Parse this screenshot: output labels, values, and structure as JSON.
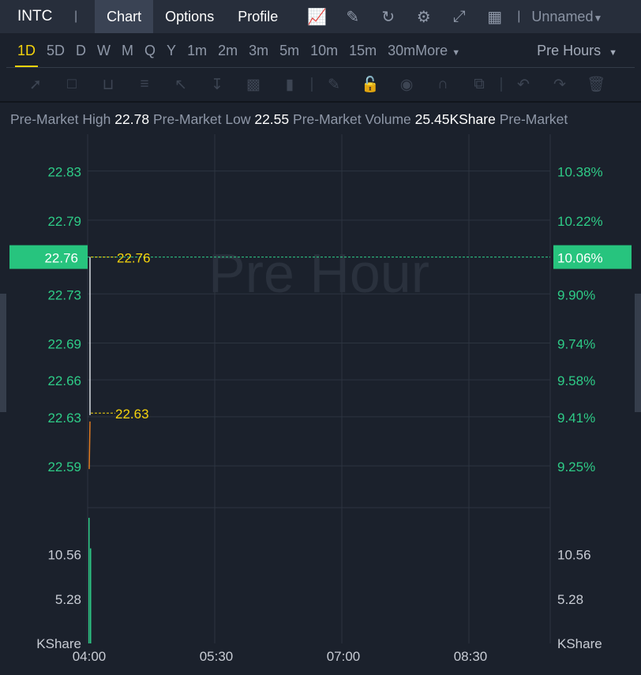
{
  "header": {
    "symbol": "INTC",
    "tabs": [
      "Chart",
      "Options",
      "Profile"
    ],
    "active_tab": "Chart",
    "layout_name": "Unnamed"
  },
  "timeframes": {
    "items": [
      "1D",
      "5D",
      "D",
      "W",
      "M",
      "Q",
      "Y",
      "1m",
      "2m",
      "3m",
      "5m",
      "10m",
      "15m",
      "30m",
      "More"
    ],
    "active": "1D",
    "session": "Pre Hours"
  },
  "info": {
    "high_label": "Pre-Market High",
    "high": "22.78",
    "low_label": "Pre-Market Low",
    "low": "22.55",
    "vol_label": "Pre-Market Volume",
    "vol": "25.45KShare",
    "trail": "Pre-Market"
  },
  "colors": {
    "up": "#2ecc87",
    "accent": "#f5d30c",
    "current": "#27c47e"
  },
  "chart_data": {
    "type": "line",
    "watermark": "Pre Hour",
    "price_ticks": [
      "22.83",
      "22.79",
      "22.73",
      "22.69",
      "22.66",
      "22.63",
      "22.59"
    ],
    "price_tick_values": [
      22.83,
      22.79,
      22.73,
      22.69,
      22.66,
      22.63,
      22.59
    ],
    "pct_ticks": [
      "10.38%",
      "10.22%",
      "9.90%",
      "9.74%",
      "9.58%",
      "9.41%",
      "9.25%"
    ],
    "current_price": "22.76",
    "current_pct": "10.06%",
    "marker_high": "22.76",
    "marker_low": "22.63",
    "ylim": [
      22.556,
      22.86
    ],
    "series": [
      {
        "name": "price",
        "x": [
          "04:00",
          "04:00",
          "04:00"
        ],
        "values": [
          22.59,
          22.63,
          22.76
        ]
      }
    ],
    "volume_ticks": [
      "10.56",
      "5.28"
    ],
    "volume_unit": "KShare",
    "volume_ylim": [
      0,
      16
    ],
    "volume": [
      {
        "x": "04:00",
        "value": 14.8
      },
      {
        "x": "04:01",
        "value": 11.2
      }
    ],
    "x_ticks": [
      "04:00",
      "05:30",
      "07:00",
      "08:30"
    ]
  }
}
